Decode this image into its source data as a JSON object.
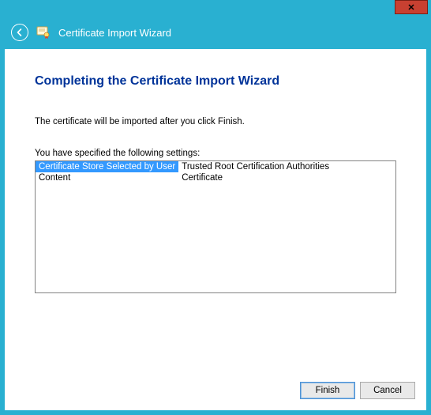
{
  "window": {
    "close_glyph": "✕"
  },
  "header": {
    "title": "Certificate Import Wizard"
  },
  "main": {
    "heading": "Completing the Certificate Import Wizard",
    "instruction": "The certificate will be imported after you click Finish.",
    "settings_label": "You have specified the following settings:",
    "rows": [
      {
        "key": "Certificate Store Selected by User",
        "value": "Trusted Root Certification Authorities",
        "selected": true
      },
      {
        "key": "Content",
        "value": "Certificate",
        "selected": false
      }
    ]
  },
  "buttons": {
    "finish": "Finish",
    "cancel": "Cancel"
  }
}
